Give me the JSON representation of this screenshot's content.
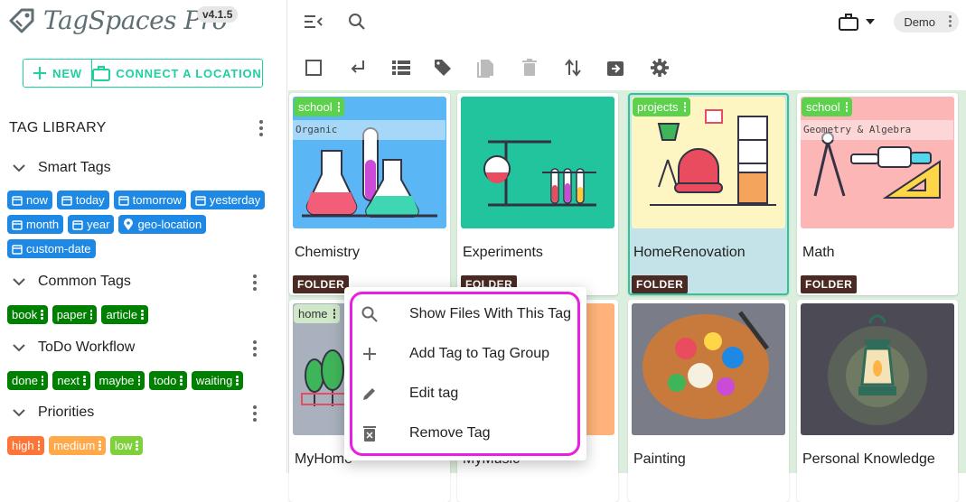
{
  "app": {
    "name": "TagSpaces Pro",
    "version": "v4.1.5"
  },
  "sidebar": {
    "new_label": "NEW",
    "connect_label": "CONNECT A LOCATION",
    "tag_library_label": "TAG LIBRARY",
    "groups": [
      {
        "name": "Smart Tags",
        "tags": [
          "now",
          "today",
          "tomorrow",
          "yesterday",
          "month",
          "year",
          "geo-location",
          "custom-date"
        ]
      },
      {
        "name": "Common Tags",
        "tags": [
          "book",
          "paper",
          "article"
        ]
      },
      {
        "name": "ToDo Workflow",
        "tags": [
          "done",
          "next",
          "maybe",
          "todo",
          "waiting"
        ]
      },
      {
        "name": "Priorities",
        "tags": [
          "high",
          "medium",
          "low"
        ]
      }
    ]
  },
  "topbar": {
    "workspace_label": "Demo"
  },
  "cards": [
    {
      "title": "Chemistry",
      "type": "FOLDER",
      "tag": "school",
      "description": "Organic"
    },
    {
      "title": "Experiments",
      "type": "FOLDER"
    },
    {
      "title": "HomeRenovation",
      "type": "FOLDER",
      "tag": "projects"
    },
    {
      "title": "Math",
      "type": "FOLDER",
      "tag": "school",
      "description": "Geometry & Algebra"
    },
    {
      "title": "MyHome",
      "tag": "home"
    },
    {
      "title": "MyMusic"
    },
    {
      "title": "Painting"
    },
    {
      "title": "Personal Knowledge"
    }
  ],
  "context_menu": {
    "items": [
      {
        "label": "Show Files With This Tag",
        "icon": "search-icon"
      },
      {
        "label": "Add Tag to Tag Group",
        "icon": "plus-icon"
      },
      {
        "label": "Edit tag",
        "icon": "pencil-icon"
      },
      {
        "label": "Remove Tag",
        "icon": "trash-icon"
      }
    ]
  },
  "colors": {
    "accent": "#1dd19f",
    "smart_tag": "#1e88e5",
    "tag_green": "#008000",
    "highlight": "#e91ee0",
    "folder_badge": "#4a2a22"
  }
}
